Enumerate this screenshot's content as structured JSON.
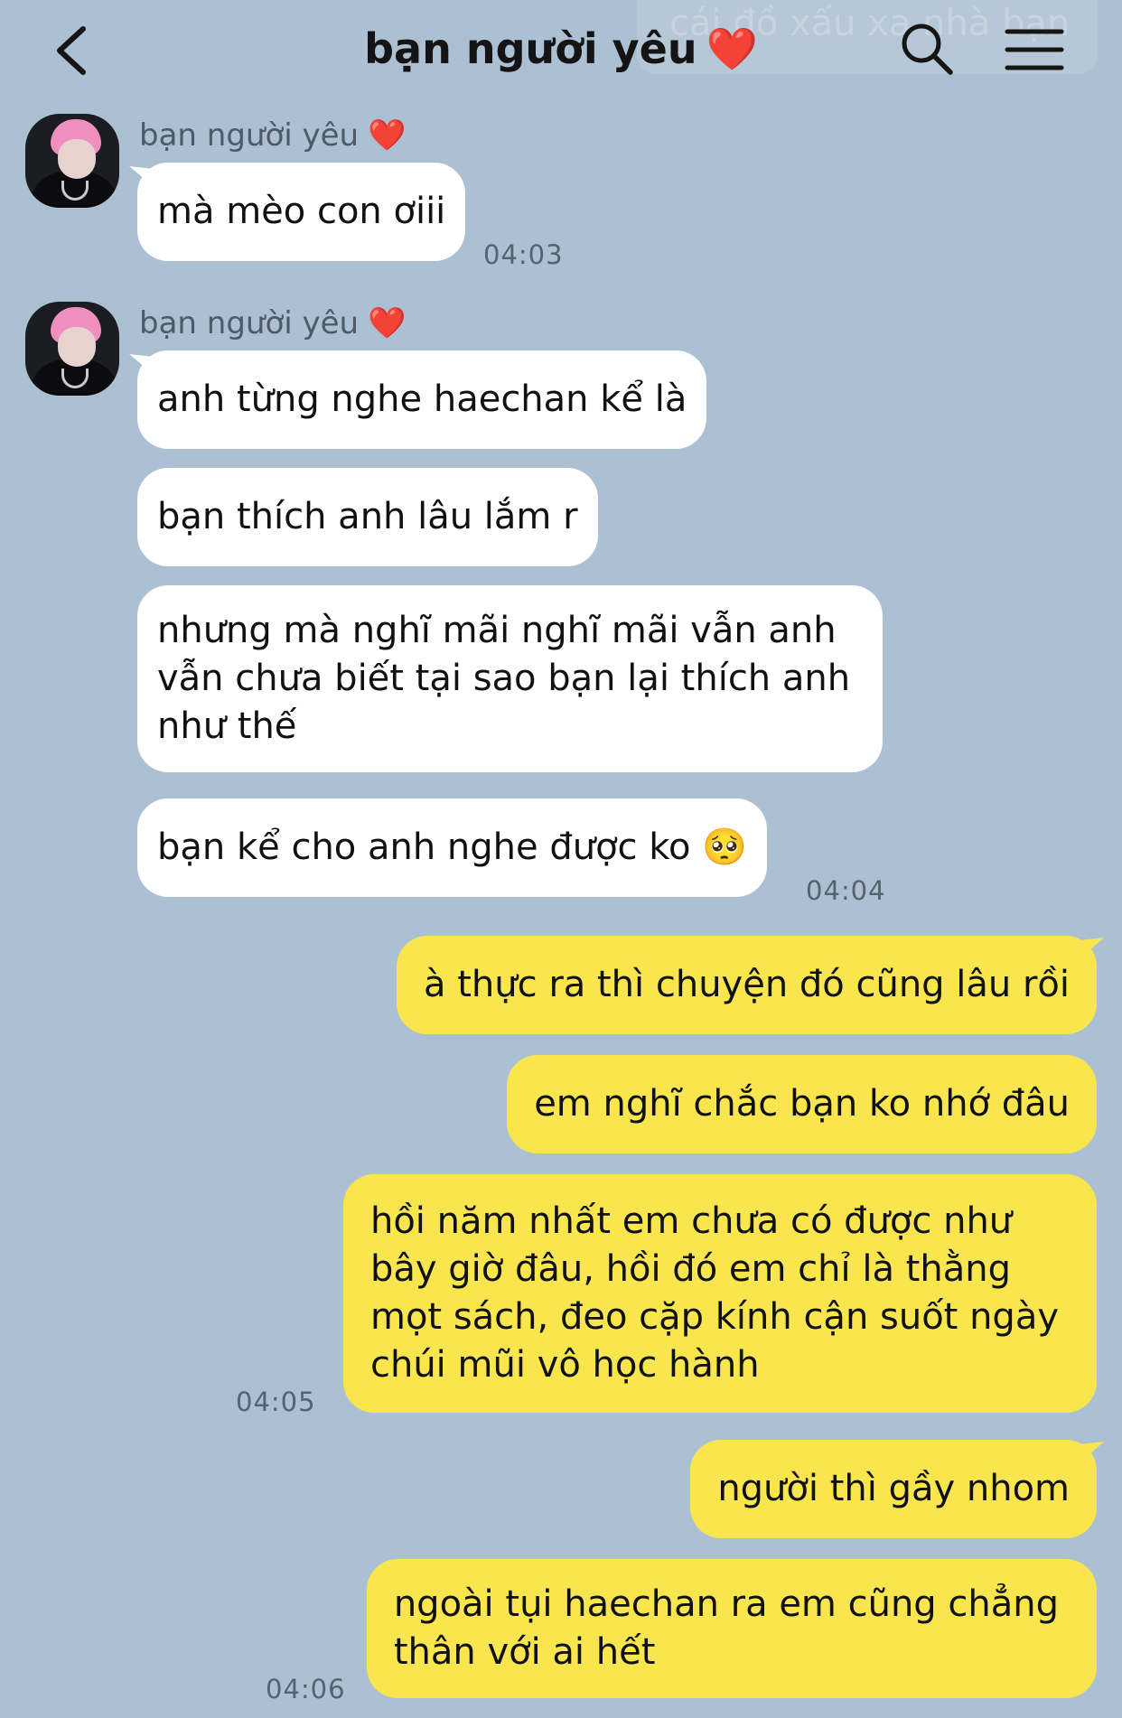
{
  "header": {
    "title": "bạn người yêu",
    "title_emoji": "❤️",
    "ghost_text": "cái đồ xấu xa nhà bạn",
    "back_icon": "chevron-left-icon",
    "search_icon": "search-icon",
    "menu_icon": "hamburger-menu-icon"
  },
  "colors": {
    "background": "#acc0d3",
    "incoming_bubble": "#ffffff",
    "outgoing_bubble": "#f9e64e",
    "heart": "#e5322d"
  },
  "messages": {
    "group1": {
      "sender": "bạn người yêu",
      "sender_emoji": "❤️",
      "bubbles": [
        "mà mèo con ơiii"
      ],
      "time": "04:03"
    },
    "group2": {
      "sender": "bạn người yêu",
      "sender_emoji": "❤️",
      "bubbles": [
        "anh từng nghe haechan kể là",
        "bạn thích anh lâu lắm r",
        "nhưng mà nghĩ mãi nghĩ mãi vẫn anh\nvẫn chưa biết tại sao bạn lại thích anh\nnhư thế",
        "bạn kể cho anh nghe được ko 🥺"
      ],
      "time": "04:04"
    },
    "group3": {
      "bubbles": [
        "à thực ra thì chuyện đó cũng lâu rồi",
        "em nghĩ chắc bạn ko nhớ đâu",
        "hồi năm nhất em chưa có được như\nbây giờ đâu, hồi đó em chỉ là thằng\nmọt sách, đeo cặp kính cận suốt ngày\nchúi mũi vô học hành"
      ],
      "time": "04:05"
    },
    "group4": {
      "bubbles": [
        "người thì gầy nhom",
        "ngoài tụi haechan ra em cũng chẳng\nthân với ai hết"
      ],
      "time": "04:06"
    }
  }
}
